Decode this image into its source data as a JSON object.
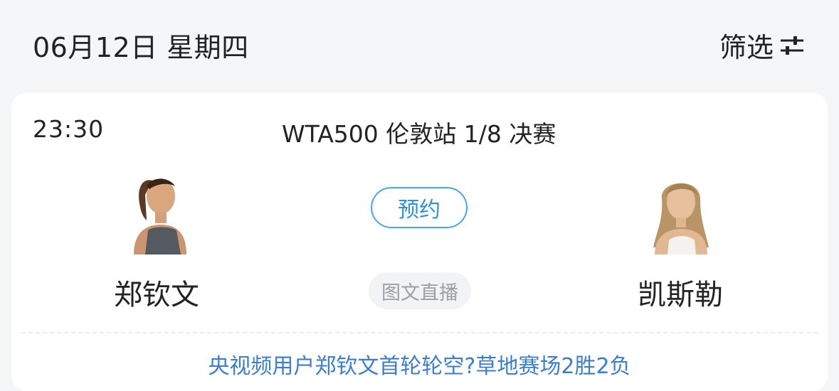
{
  "header": {
    "date": "06月12日 星期四",
    "filter_label": "筛选"
  },
  "match": {
    "time": "23:30",
    "title": "WTA500 伦敦站 1/8 决赛",
    "home_player": {
      "name": "郑钦文"
    },
    "away_player": {
      "name": "凯斯勒"
    },
    "reserve_label": "预约",
    "live_label": "图文直播",
    "note": "央视频用户郑钦文首轮轮空?草地赛场2胜2负"
  },
  "colors": {
    "background": "#f5f6f8",
    "card": "#ffffff",
    "accent": "#4aa6e8",
    "note_text": "#3d7ec9"
  }
}
